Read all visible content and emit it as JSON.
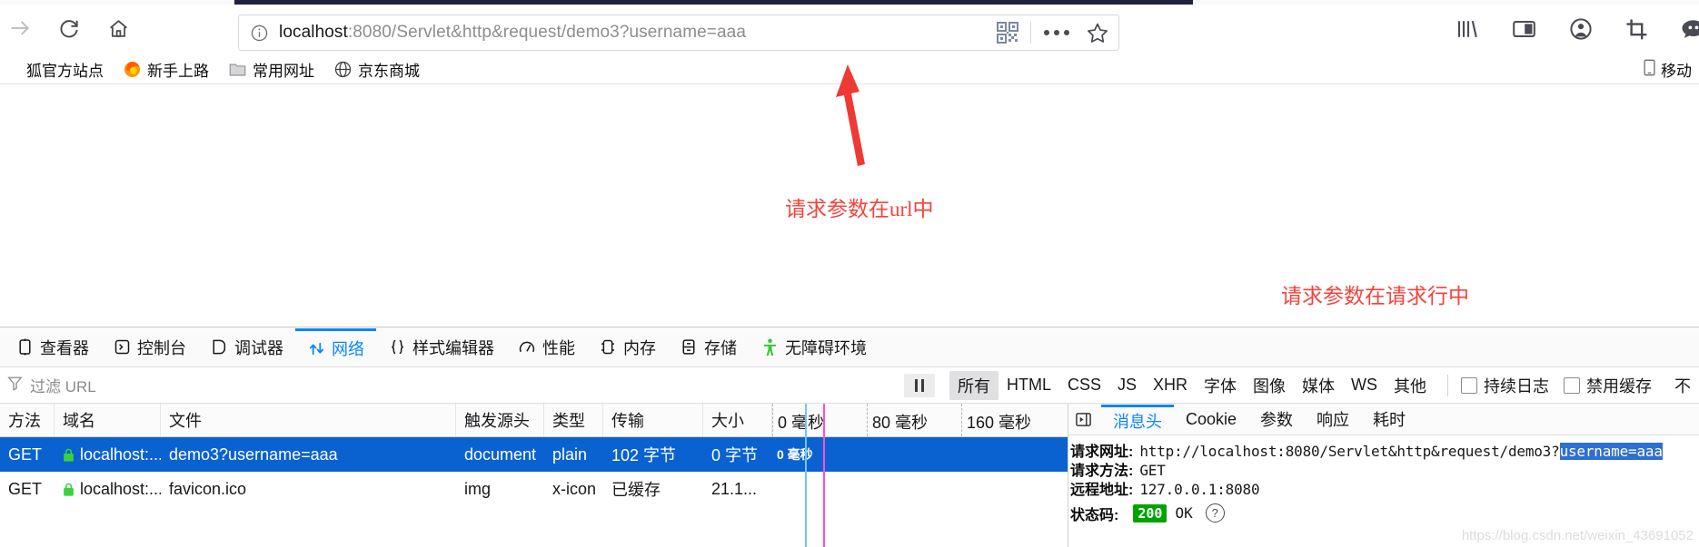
{
  "browser": {
    "nav": {
      "forward_icon": "arrow-right-icon",
      "reload_icon": "reload-icon",
      "home_icon": "home-icon"
    },
    "urlbar": {
      "info_icon": "info-circle-icon",
      "host": "localhost",
      "path": ":8080/Servlet&http&request/demo3?username=aaa",
      "full_url": "localhost:8080/Servlet&http&request/demo3?username=aaa",
      "qr_icon": "qr-code-icon",
      "more_icon": "ellipsis-icon",
      "bookmark_icon": "star-icon"
    },
    "toolbar_right": [
      {
        "icon": "library-icon"
      },
      {
        "icon": "sidebar-icon"
      },
      {
        "icon": "account-icon"
      },
      {
        "icon": "screenshot-crop-icon"
      },
      {
        "icon": "pocket-chat-icon"
      }
    ],
    "bookmarks": [
      {
        "label": "狐官方站点",
        "icon": "none"
      },
      {
        "label": "新手上路",
        "icon": "firefox-icon"
      },
      {
        "label": "常用网址",
        "icon": "folder-icon"
      },
      {
        "label": "京东商城",
        "icon": "globe-icon"
      }
    ],
    "bookmarks_right": {
      "label": "移动",
      "icon": "mobile-icon"
    }
  },
  "annotations": [
    {
      "text": "请求参数在url中",
      "color": "#f4433d"
    },
    {
      "text": "请求参数在请求行中",
      "color": "#f4433d"
    }
  ],
  "devtools": {
    "tabs": [
      {
        "label": "查看器",
        "icon": "inspector-icon",
        "active": false
      },
      {
        "label": "控制台",
        "icon": "console-icon",
        "active": false
      },
      {
        "label": "调试器",
        "icon": "debugger-icon",
        "active": false
      },
      {
        "label": "网络",
        "icon": "network-icon",
        "active": true
      },
      {
        "label": "样式编辑器",
        "icon": "style-editor-icon",
        "active": false
      },
      {
        "label": "性能",
        "icon": "performance-icon",
        "active": false
      },
      {
        "label": "内存",
        "icon": "memory-icon",
        "active": false
      },
      {
        "label": "存储",
        "icon": "storage-icon",
        "active": false
      },
      {
        "label": "无障碍环境",
        "icon": "accessibility-icon",
        "active": false
      }
    ],
    "filter": {
      "icon": "filter-icon",
      "placeholder": "过滤 URL",
      "value": "",
      "pause_icon": "pause-icon",
      "types": [
        "所有",
        "HTML",
        "CSS",
        "JS",
        "XHR",
        "字体",
        "图像",
        "媒体",
        "WS",
        "其他"
      ],
      "active_type": "所有",
      "checkboxes": [
        {
          "label": "持续日志",
          "checked": false
        },
        {
          "label": "禁用缓存",
          "checked": false
        }
      ],
      "overflow_label": "不"
    },
    "table": {
      "columns": [
        "方法",
        "域名",
        "文件",
        "触发源头",
        "类型",
        "传输",
        "大小"
      ],
      "timeline_ticks": [
        "0 毫秒",
        "80 毫秒",
        "160 毫秒"
      ],
      "rows": [
        {
          "method": "GET",
          "domain": "localhost:...",
          "file": "demo3?username=aaa",
          "cause": "document",
          "type": "plain",
          "transferred": "102 字节",
          "size": "0 字节",
          "timing": "0 毫秒",
          "secure": true,
          "selected": true
        },
        {
          "method": "GET",
          "domain": "localhost:...",
          "file": "favicon.ico",
          "cause": "img",
          "type": "x-icon",
          "transferred": "已缓存",
          "size": "21.1...",
          "timing": "",
          "secure": true,
          "selected": false
        }
      ]
    },
    "detail": {
      "expander_icon": "expand-panel-icon",
      "tabs": [
        {
          "label": "消息头",
          "active": true
        },
        {
          "label": "Cookie",
          "active": false
        },
        {
          "label": "参数",
          "active": false
        },
        {
          "label": "响应",
          "active": false
        },
        {
          "label": "耗时",
          "active": false
        }
      ],
      "rows": [
        {
          "key": "请求网址:",
          "value": "http://localhost:8080/Servlet&http&request/demo3?",
          "highlight": "username=aaa"
        },
        {
          "key": "请求方法:",
          "value": "GET",
          "highlight": ""
        },
        {
          "key": "远程地址:",
          "value": "127.0.0.1:8080",
          "highlight": ""
        }
      ],
      "status": {
        "key": "状态码:",
        "code": "200",
        "text": "OK",
        "help_icon": "question-circle-icon",
        "code_color": "#00a400"
      }
    },
    "watermark": "https://blog.csdn.net/weixin_43691052"
  }
}
